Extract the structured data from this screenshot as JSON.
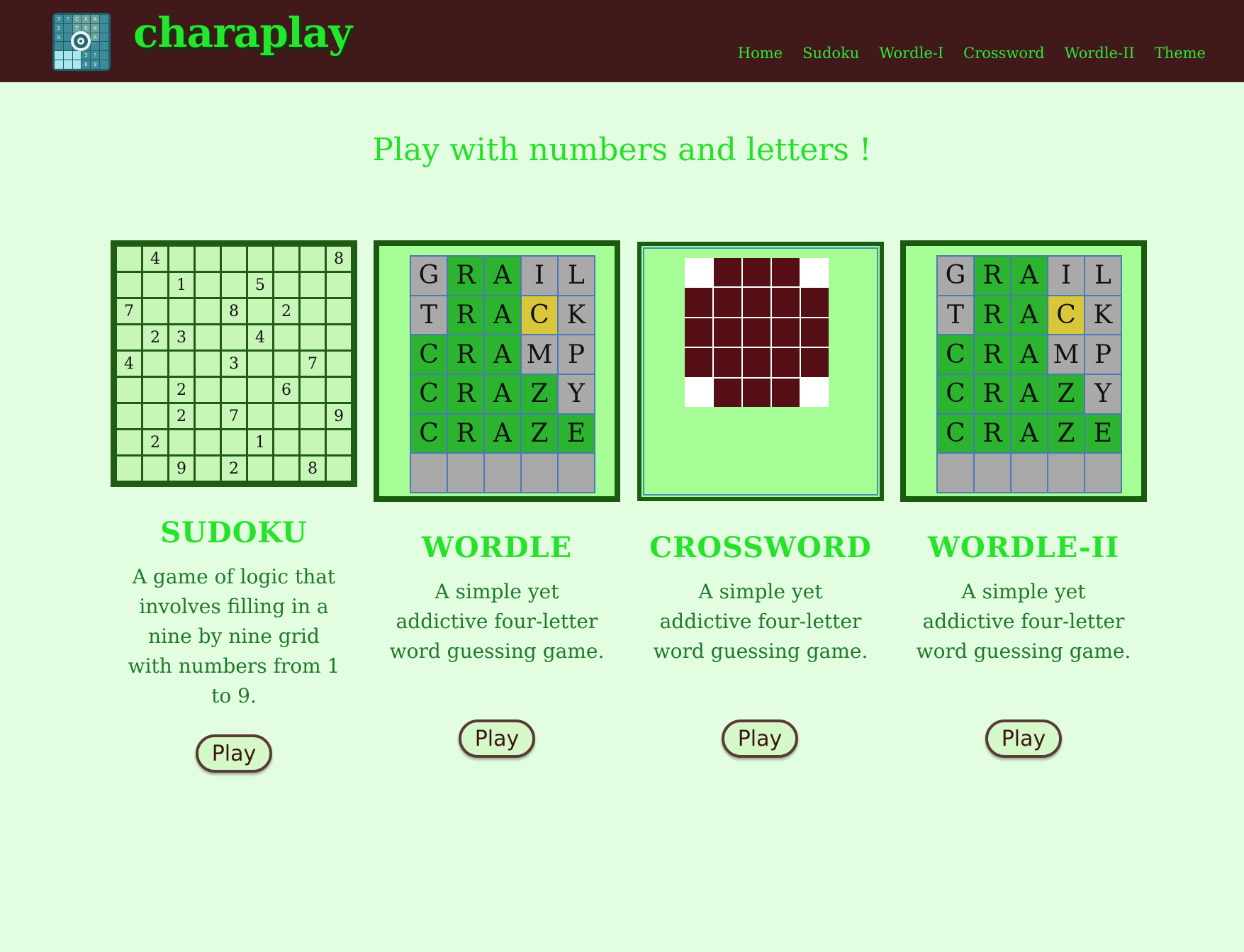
{
  "brand": "charaplay",
  "nav": [
    "Home",
    "Sudoku",
    "Wordle-I",
    "Crossword",
    "Wordle-II",
    "Theme"
  ],
  "headline": "Play with numbers and letters !",
  "cards": [
    {
      "title": "SUDOKU",
      "desc": "A game of logic that involves filling in a nine by nine grid with numbers from 1 to 9.",
      "button": "Play"
    },
    {
      "title": "WORDLE",
      "desc": "A simple yet addictive four-letter word guessing game.",
      "button": "Play"
    },
    {
      "title": "CROSSWORD",
      "desc": "A simple yet addictive four-letter word guessing game.",
      "button": "Play"
    },
    {
      "title": "WORDLE-II",
      "desc": "A simple yet addictive four-letter word guessing game.",
      "button": "Play"
    }
  ],
  "sudoku_cells": [
    "",
    "4",
    "",
    "",
    "",
    "",
    "",
    "",
    "8",
    "",
    "",
    "1",
    "",
    "",
    "5",
    "",
    "",
    "",
    "7",
    "",
    "",
    "",
    "8",
    "",
    "2",
    "",
    "",
    "",
    "2",
    "3",
    "",
    "",
    "4",
    "",
    "",
    "",
    "4",
    "",
    "",
    "",
    "3",
    "",
    "",
    "7",
    "",
    "",
    "",
    "2",
    "",
    "",
    "",
    "6",
    "",
    "",
    "",
    "",
    "2",
    "",
    "7",
    "",
    "",
    "",
    "9",
    "",
    "2",
    "",
    "",
    "",
    "1",
    "",
    "",
    "",
    "",
    "",
    "9",
    "",
    "2",
    "",
    "",
    "8",
    ""
  ],
  "wordle_rows": [
    [
      [
        "G",
        "gray"
      ],
      [
        "R",
        "green"
      ],
      [
        "A",
        "green"
      ],
      [
        "I",
        "gray"
      ],
      [
        "L",
        "gray"
      ]
    ],
    [
      [
        "T",
        "gray"
      ],
      [
        "R",
        "green"
      ],
      [
        "A",
        "green"
      ],
      [
        "C",
        "yellow"
      ],
      [
        "K",
        "gray"
      ]
    ],
    [
      [
        "C",
        "green"
      ],
      [
        "R",
        "green"
      ],
      [
        "A",
        "green"
      ],
      [
        "M",
        "gray"
      ],
      [
        "P",
        "gray"
      ]
    ],
    [
      [
        "C",
        "green"
      ],
      [
        "R",
        "green"
      ],
      [
        "A",
        "green"
      ],
      [
        "Z",
        "green"
      ],
      [
        "Y",
        "gray"
      ]
    ],
    [
      [
        "C",
        "green"
      ],
      [
        "R",
        "green"
      ],
      [
        "A",
        "green"
      ],
      [
        "Z",
        "green"
      ],
      [
        "E",
        "green"
      ]
    ],
    [
      [
        "",
        "empty"
      ],
      [
        "",
        "empty"
      ],
      [
        "",
        "empty"
      ],
      [
        "",
        "empty"
      ],
      [
        "",
        "empty"
      ]
    ]
  ],
  "crossword_pattern": [
    "WBBBW",
    "BBBBB",
    "BBBBB",
    "BBBBB",
    "WBBBW"
  ],
  "colors": {
    "topbar": "#41191a",
    "accent": "#26e22b",
    "page_bg": "#e3fde1",
    "dark_cell": "#561015"
  }
}
